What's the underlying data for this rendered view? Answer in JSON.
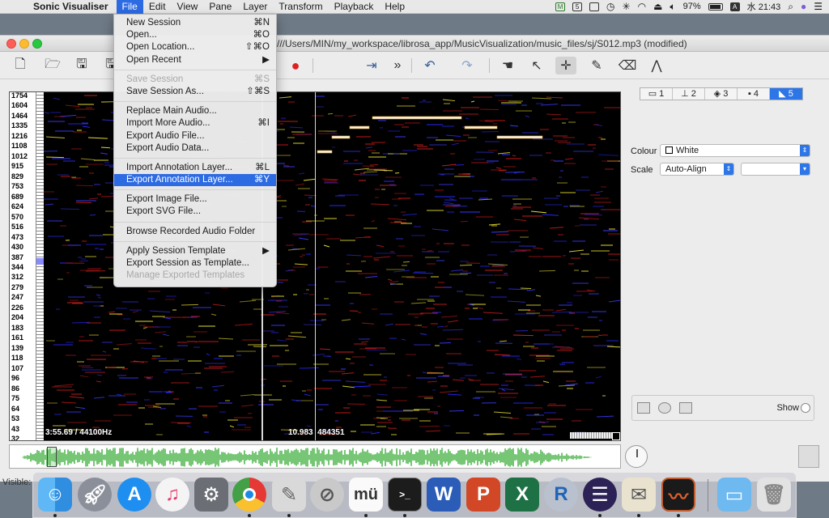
{
  "menubar": {
    "apple": "",
    "app_name": "Sonic Visualiser",
    "items": [
      "File",
      "Edit",
      "View",
      "Pane",
      "Layer",
      "Transform",
      "Playback",
      "Help"
    ],
    "status_battery": "97%",
    "status_input": "A",
    "status_clock": "水 21:43"
  },
  "window": {
    "title": "///Users/MIN/my_workspace/librosa_app/MusicVisualization/music_files/sj/S012.mp3 (modified)"
  },
  "file_menu": {
    "items": [
      {
        "label": "New Session",
        "shortcut": "⌘N"
      },
      {
        "label": "Open...",
        "shortcut": "⌘O"
      },
      {
        "label": "Open Location...",
        "shortcut": "⇧⌘O"
      },
      {
        "label": "Open Recent",
        "shortcut": "▶"
      },
      {
        "label": "Save Session",
        "shortcut": "⌘S"
      },
      {
        "label": "Save Session As...",
        "shortcut": "⇧⌘S"
      },
      {
        "label": "Replace Main Audio..."
      },
      {
        "label": "Import More Audio...",
        "shortcut": "⌘I"
      },
      {
        "label": "Export Audio File..."
      },
      {
        "label": "Export Audio Data..."
      },
      {
        "label": "Import Annotation Layer...",
        "shortcut": "⌘L"
      },
      {
        "label": "Export Annotation Layer...",
        "shortcut": "⌘Y"
      },
      {
        "label": "Export Image File..."
      },
      {
        "label": "Export SVG File..."
      },
      {
        "label": "Browse Recorded Audio Folder"
      },
      {
        "label": "Apply Session Template",
        "shortcut": "▶"
      },
      {
        "label": "Export Session as Template..."
      },
      {
        "label": "Manage Exported Templates"
      }
    ]
  },
  "spectrogram": {
    "scale_ticks": [
      "1754",
      "1604",
      "1464",
      "1335",
      "1216",
      "1108",
      "1012",
      "915",
      "829",
      "753",
      "689",
      "624",
      "570",
      "516",
      "473",
      "430",
      "387",
      "344",
      "312",
      "279",
      "247",
      "226",
      "204",
      "183",
      "161",
      "139",
      "118",
      "107",
      "96",
      "86",
      "75",
      "64",
      "53",
      "43",
      "32"
    ],
    "time_left": "3:55.69 / 44100Hz",
    "time_mid": "10.983",
    "sample_mid": "484351"
  },
  "properties": {
    "layer_tabs": [
      "1",
      "2",
      "3",
      "4",
      "5"
    ],
    "colour_label": "Colour",
    "colour_value": "White",
    "scale_label": "Scale",
    "scale_value": "Auto-Align",
    "scale_value2": "",
    "show_label": "Show"
  },
  "status": {
    "visible_label": "Visible:"
  },
  "accent_color": "#2d6be3",
  "dock": {
    "apps": [
      "Finder",
      "Launchpad",
      "App Store",
      "iTunes",
      "System Preferences",
      "Chrome",
      "Script",
      "Prohibited",
      "Mu",
      "Terminal",
      "Word",
      "PowerPoint",
      "Excel",
      "R",
      "Eclipse",
      "Preview",
      "Sonic Visualiser",
      "Downloads",
      "Trash"
    ]
  }
}
